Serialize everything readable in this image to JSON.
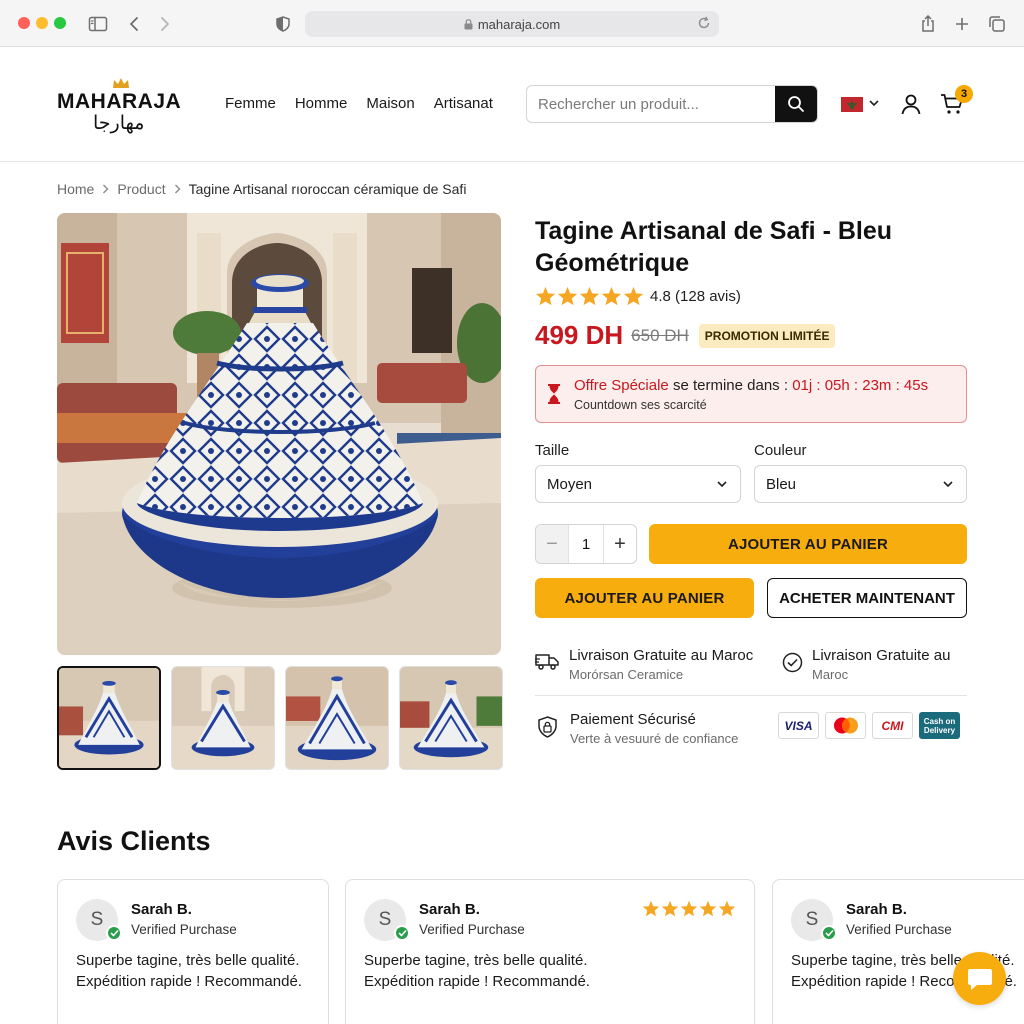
{
  "browser": {
    "url": "maharaja.com"
  },
  "brand": {
    "name_latin": "MAHARAJA",
    "name_arabic": "مهارجا"
  },
  "nav": {
    "items": [
      "Femme",
      "Homme",
      "Maison",
      "Artisanat"
    ]
  },
  "search": {
    "placeholder": "Rechercher un produit..."
  },
  "cart": {
    "count": "3"
  },
  "breadcrumb": {
    "home": "Home",
    "product": "Product",
    "current": "Tagine Artisanal rıoroccan céramique de Safi"
  },
  "product": {
    "title": "Tagine Artisanal de Safi - Bleu Géométrique",
    "rating": 4.8,
    "rating_text": "4.8 (128 avis)",
    "price": "499 DH",
    "old_price": "650 DH",
    "promo_badge": "PROMOTION LIMITÉE"
  },
  "offer": {
    "label": "Offre Spéciale",
    "middle": " se termine dans : ",
    "countdown": "01j : 05h : 23m : 45s",
    "subtext": "Countdown ses scarcité"
  },
  "options": {
    "size_label": "Taille",
    "size_value": "Moyen",
    "color_label": "Couleur",
    "color_value": "Bleu"
  },
  "quantity": {
    "value": "1",
    "minus": "−",
    "plus": "+"
  },
  "actions": {
    "add_to_cart_wide": "AJOUTER AU PANIER",
    "add_to_cart": "AJOUTER AU PANIER",
    "buy_now": "ACHETER MAINTENANT"
  },
  "features": {
    "delivery_title": "Livraison Gratuite au Maroc",
    "delivery_sub": "Morórsan Ceramice",
    "delivery2_title": "Livraison Gratuite au",
    "delivery2_sub": "Maroc",
    "payment_title": "Paiement Sécurisé",
    "payment_sub": "Verte à vesuuré de confiance"
  },
  "payments": {
    "visa": "VISA",
    "cmi": "CMI",
    "cod": "Cash on Delivery"
  },
  "reviews": {
    "title": "Avis Clients",
    "items": [
      {
        "initial": "S",
        "name": "Sarah B.",
        "verified": "Verified Purchase",
        "text": "Superbe tagine, très belle qualité. Expédition rapide ! Recommandé."
      },
      {
        "initial": "S",
        "name": "Sarah B.",
        "verified": "Verified Purchase",
        "text": "Superbe tagine, très belle qualité. Expédition rapide ! Recommandé.",
        "stars": 5
      },
      {
        "initial": "S",
        "name": "Sarah B.",
        "verified": "Verified Purchase",
        "text": "Superbe tagine, très belle qualité. Expédition rapide ! Recommandé."
      }
    ]
  },
  "colors": {
    "accent": "#f8ad0e",
    "price_red": "#c8171e",
    "star": "#f5a623",
    "offer_bg": "#fdeeee"
  }
}
